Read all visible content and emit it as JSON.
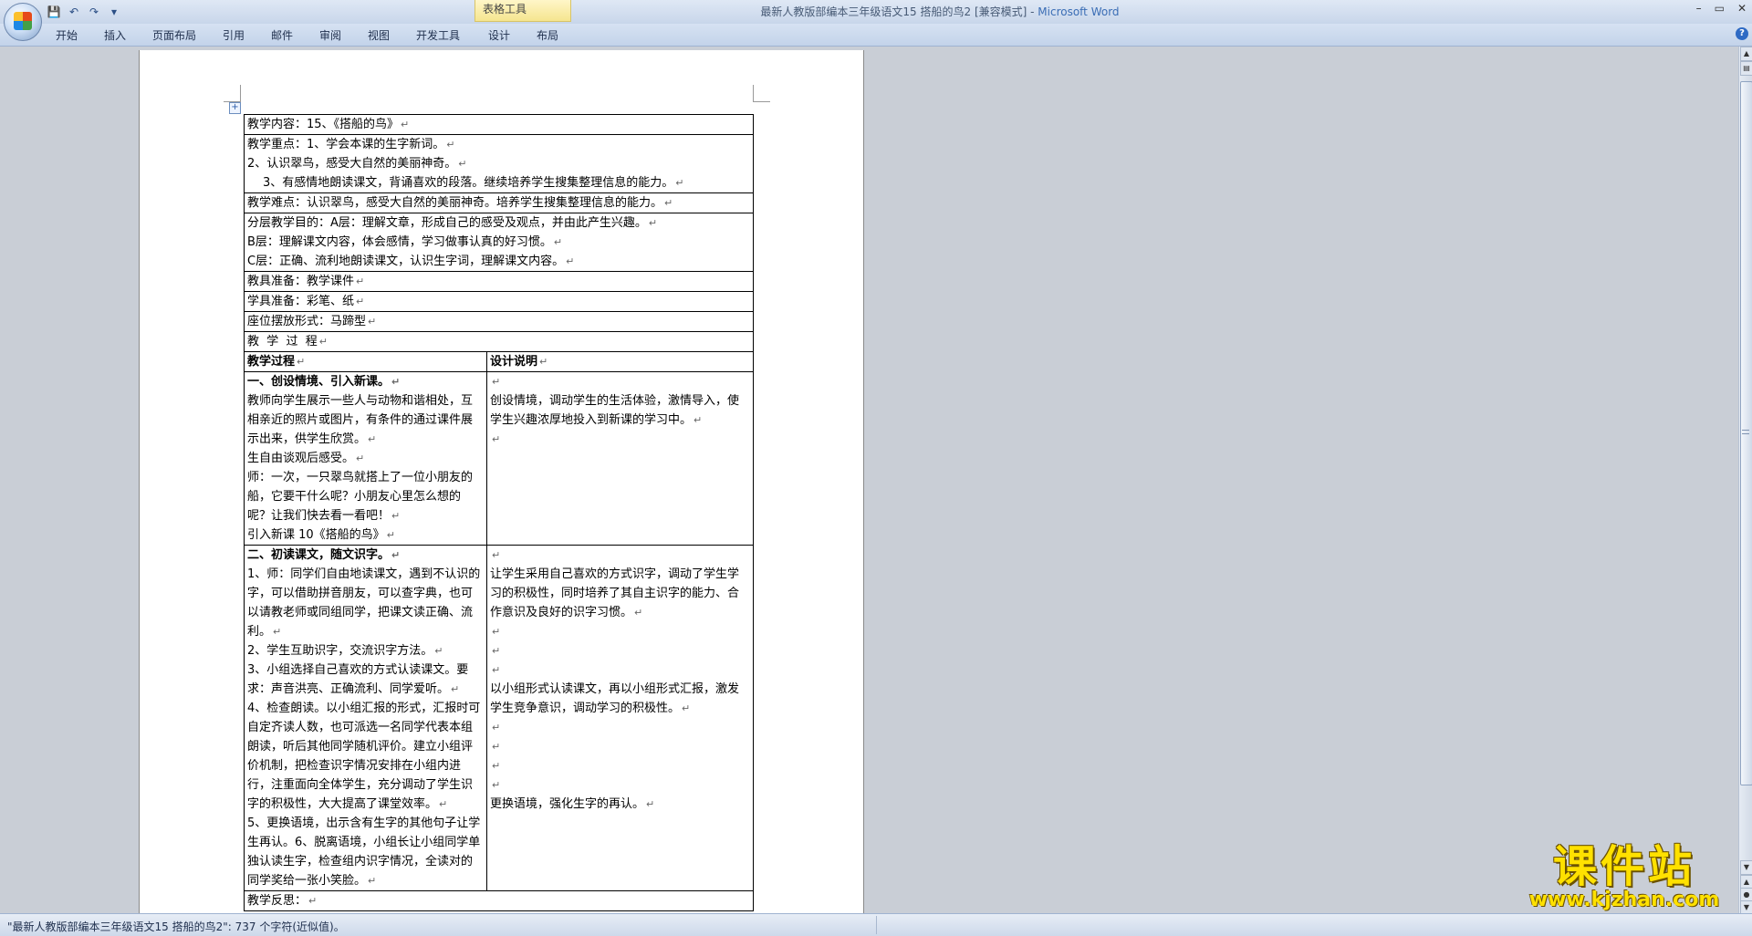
{
  "window": {
    "title": "最新人教版部编本三年级语文15 搭船的鸟2 [兼容模式] - ",
    "app_name": "Microsoft Word",
    "context_tab_group": "表格工具",
    "controls": [
      "–",
      "▭",
      "✕"
    ]
  },
  "quick_access": {
    "save_icon": "💾",
    "undo_icon": "↶",
    "redo_icon": "↷",
    "customize_icon": "▾"
  },
  "ribbon_tabs": [
    "开始",
    "插入",
    "页面布局",
    "引用",
    "邮件",
    "审阅",
    "视图",
    "开发工具",
    "设计",
    "布局"
  ],
  "table": {
    "rows": [
      {
        "type": "single",
        "lines": [
          "教学内容：15、《搭船的鸟》"
        ]
      },
      {
        "type": "single",
        "lines": [
          "教学重点：1、学会本课的生字新词。",
          "2、认识翠鸟，感受大自然的美丽神奇。",
          "3、有感情地朗读课文，背诵喜欢的段落。继续培养学生搜集整理信息的能力。"
        ]
      },
      {
        "type": "single",
        "lines": [
          "教学难点：认识翠鸟，感受大自然的美丽神奇。培养学生搜集整理信息的能力。"
        ]
      },
      {
        "type": "single",
        "lines": [
          "分层教学目的：A层：理解文章，形成自己的感受及观点，并由此产生兴趣。",
          "B层：理解课文内容，体会感情，学习做事认真的好习惯。",
          "C层：正确、流利地朗读课文，认识生字词，理解课文内容。"
        ]
      },
      {
        "type": "single",
        "lines": [
          "教具准备：教学课件"
        ]
      },
      {
        "type": "single",
        "lines": [
          "学具准备：彩笔、纸"
        ]
      },
      {
        "type": "single",
        "lines": [
          "座位摆放形式：马蹄型"
        ]
      },
      {
        "type": "single",
        "lines": [
          "教  学  过  程"
        ]
      }
    ],
    "process_header": {
      "left": "教学过程",
      "right": "设计说明"
    },
    "section1": {
      "left_heading": "一、创设情境、引入新课。",
      "left_paras": [
        "教师向学生展示一些人与动物和谐相处，互相亲近的照片或图片，有条件的通过课件展示出来，供学生欣赏。",
        "生自由谈观后感受。",
        "师：一次，一只翠鸟就搭上了一位小朋友的船，它要干什么呢？小朋友心里怎么想的呢？让我们快去看一看吧！",
        "引入新课 10《搭船的鸟》"
      ],
      "right_paras": [
        "",
        "创设情境，调动学生的生活体验，激情导入，使学生兴趣浓厚地投入到新课的学习中。",
        ""
      ]
    },
    "section2": {
      "left_heading": "二、初读课文，随文识字。",
      "left_paras": [
        "1、师：同学们自由地读课文，遇到不认识的字，可以借助拼音朋友，可以查字典，也可以请教老师或同组同学，把课文读正确、流利。",
        "2、学生互助识字，交流识字方法。",
        "3、小组选择自己喜欢的方式认读课文。要求：声音洪亮、正确流利、同学爱听。",
        "4、检查朗读。以小组汇报的形式，汇报时可自定齐读人数，也可派选一名同学代表本组朗读，听后其他同学随机评价。建立小组评价机制，把检查识字情况安排在小组内进行，注重面向全体学生，充分调动了学生识字的积极性，大大提高了课堂效率。",
        "5、更换语境，出示含有生字的其他句子让学生再认。6、脱离语境，小组长让小组同学单独认读生字，检查组内识字情况，全读对的同学奖给一张小笑脸。"
      ],
      "right_paras": [
        "",
        "让学生采用自己喜欢的方式识字，调动了学生学习的积极性，同时培养了其自主识字的能力、合作意识及良好的识字习惯。",
        "",
        "",
        "",
        "以小组形式认读课文，再以小组形式汇报，激发学生竞争意识，调动学习的积极性。",
        "",
        "",
        "",
        "",
        "更换语境，强化生字的再认。"
      ]
    },
    "footer_row": "教学反思："
  },
  "marks": {
    "para": "↵",
    "cell_end": "↵"
  },
  "statusbar": {
    "text": "\"最新人教版部编本三年级语文15 搭船的鸟2\": 737 个字符(近似值)。"
  },
  "watermark": {
    "title": "课件站",
    "url": "www.kjzhan.com"
  }
}
